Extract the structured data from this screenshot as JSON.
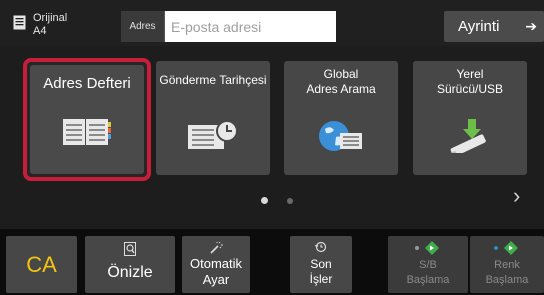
{
  "topbar": {
    "original_label": "Orijinal",
    "original_size": "A4",
    "address_prefix": "Adres",
    "address_placeholder": "E-posta adresi",
    "address_value": "",
    "detail_label": "Ayrinti",
    "detail_icon": "arrow-right-icon"
  },
  "tiles": [
    {
      "label": "Adres Defteri",
      "icon": "address-book-icon",
      "selected": true
    },
    {
      "label": "Gönderme Tarihçesi",
      "icon": "history-list-clock-icon",
      "selected": false
    },
    {
      "label_line1": "Global",
      "label_line2": "Adres Arama",
      "icon": "globe-address-icon",
      "selected": false
    },
    {
      "label_line1": "Yerel",
      "label_line2": "Sürücü/USB",
      "icon": "usb-drive-icon",
      "selected": false
    }
  ],
  "pager": {
    "pages": 2,
    "current": 1
  },
  "bottombar": {
    "ca": "CA",
    "preview": "Önizle",
    "auto_line1": "Otomatik",
    "auto_line2": "Ayar",
    "jobs_line1": "Son",
    "jobs_line2": "İşler",
    "bw_line1": "S/B",
    "bw_line2": "Başlama",
    "color_line1": "Renk",
    "color_line2": "Başlama"
  },
  "colors": {
    "accent_red": "#c81e3b",
    "ca_yellow": "#f3c412",
    "start_green": "#3fae49",
    "usb_green": "#6cc04a",
    "tile_bg": "#474747"
  }
}
